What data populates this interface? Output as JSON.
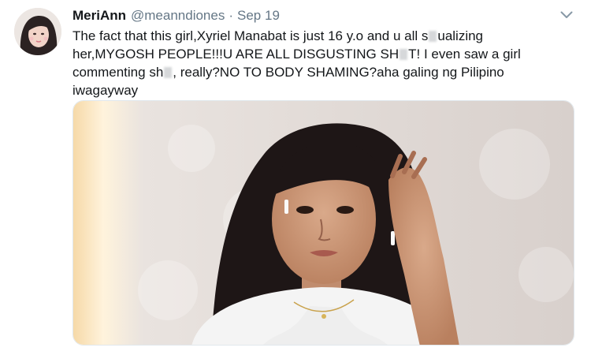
{
  "tweet": {
    "display_name": "MeriAnn",
    "handle": "@meanndiones",
    "separator": "·",
    "time": "Sep 19",
    "text": {
      "line1_a": "The fact that this girl,Xyriel Manabat is just 16 y.o and u all  s",
      "line1_b": "ualizing",
      "line2_a": "her,MYGOSH PEOPLE!!!U ARE ALL DISGUSTING SH",
      "line2_b": "T! I even saw a girl",
      "line3_a": "commenting sh",
      "line3_b": ", really?NO TO BODY SHAMING?aha galing ng Pilipino",
      "line4": "iwagayway"
    }
  },
  "icons": {
    "avatar": "profile-photo",
    "caret": "chevron-down-icon"
  },
  "colors": {
    "name": "#14171a",
    "secondary": "#657786",
    "border": "#e1e8ed"
  }
}
